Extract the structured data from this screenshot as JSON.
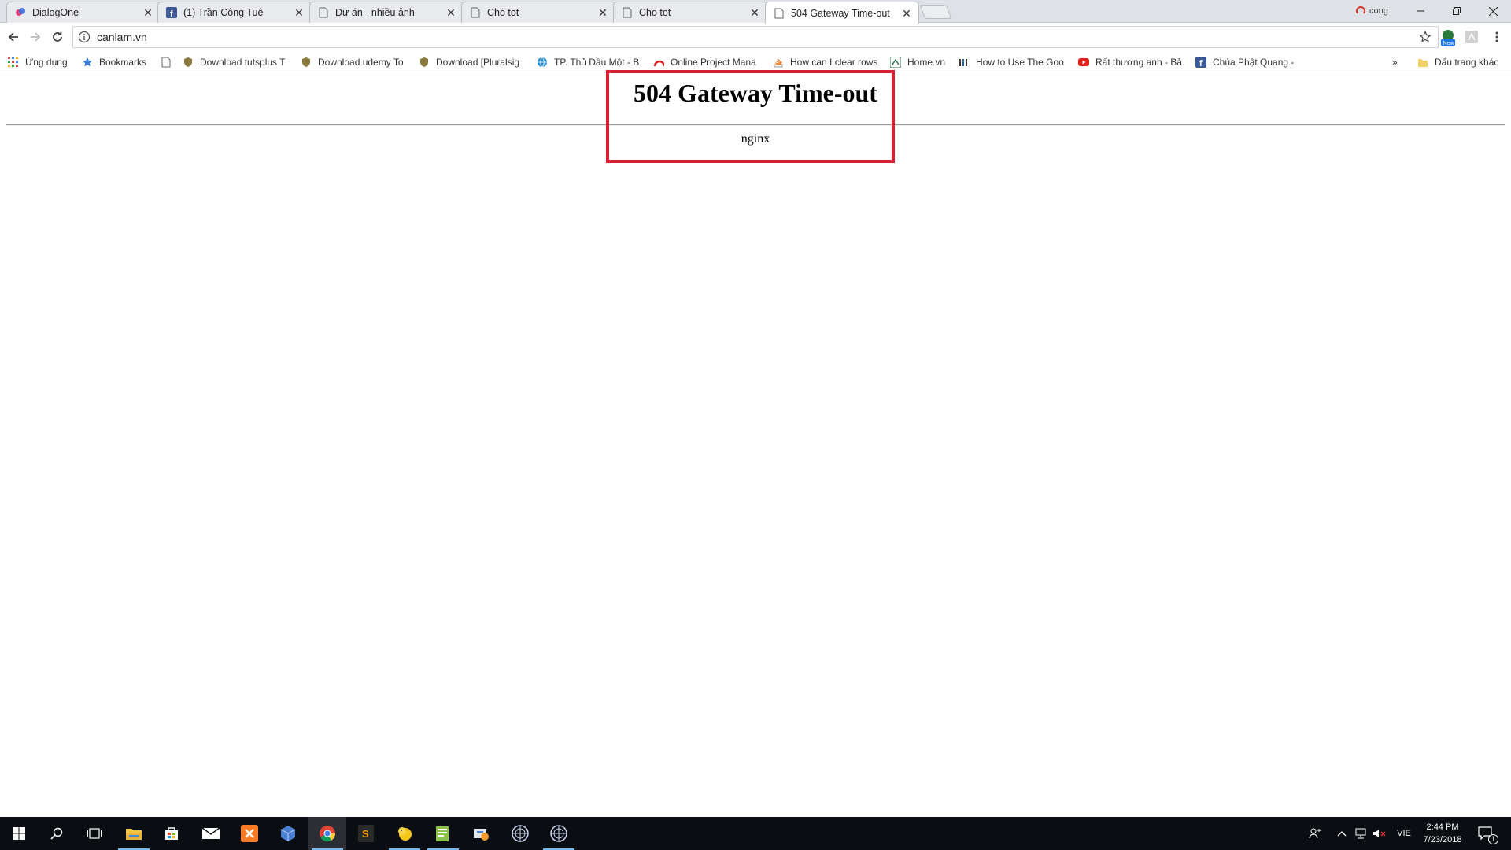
{
  "tabs": [
    {
      "title": "DialogOne",
      "icon": "dialogone-icon",
      "active": false
    },
    {
      "title": "(1) Trần Công Tuệ",
      "icon": "facebook-icon",
      "active": false
    },
    {
      "title": "Dự án - nhiều ảnh",
      "icon": "page-icon",
      "active": false
    },
    {
      "title": "Cho tot",
      "icon": "page-icon",
      "active": false
    },
    {
      "title": "Cho tot",
      "icon": "page-icon",
      "active": false
    },
    {
      "title": "504 Gateway Time-out",
      "icon": "page-icon",
      "active": true
    }
  ],
  "profile": {
    "label": "cong"
  },
  "toolbar": {
    "url": "canlam.vn"
  },
  "bookmarks": {
    "apps_label": "Ứng dụng",
    "items": [
      {
        "label": "Bookmarks",
        "icon": "star-icon"
      },
      {
        "label": "",
        "icon": "page-icon"
      },
      {
        "label": "Download tutsplus T",
        "icon": "shield-icon"
      },
      {
        "label": "Download udemy To",
        "icon": "shield-icon"
      },
      {
        "label": "Download [Pluralsig",
        "icon": "shield-icon"
      },
      {
        "label": "TP. Thủ Dầu Một - B",
        "icon": "globe-icon"
      },
      {
        "label": "Online Project Mana",
        "icon": "arc-icon"
      },
      {
        "label": "How can I clear rows",
        "icon": "stackoverflow-icon"
      },
      {
        "label": "Home.vn",
        "icon": "homevn-icon"
      },
      {
        "label": "How to Use The Goo",
        "icon": "bars-icon"
      },
      {
        "label": "Rất thương anh - Bả",
        "icon": "youtube-icon"
      },
      {
        "label": "Chùa Phật Quang - ",
        "icon": "facebook-icon"
      }
    ],
    "overflow": "»",
    "other_label": "Dấu trang khác"
  },
  "page": {
    "title": "504 Gateway Time-out",
    "server": "nginx"
  },
  "taskbar": {
    "language": "VIE",
    "time": "2:44 PM",
    "date": "7/23/2018",
    "notification_count": "1"
  },
  "colors": {
    "highlight": "#dc1f2e",
    "taskbar": "#0a0d12",
    "tabstrip": "#dee1e6"
  }
}
